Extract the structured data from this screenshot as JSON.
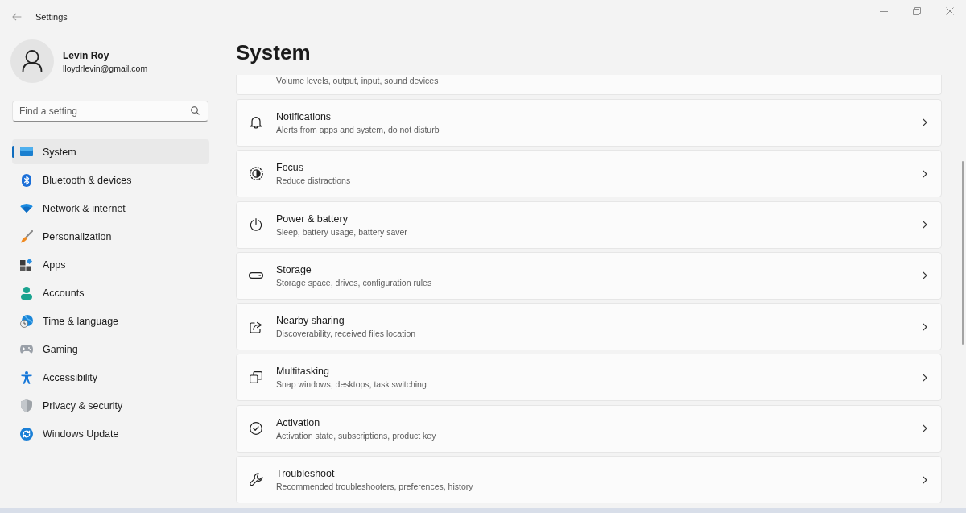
{
  "window": {
    "title": "Settings"
  },
  "profile": {
    "name": "Levin Roy",
    "email": "lloydrlevin@gmail.com"
  },
  "search": {
    "placeholder": "Find a setting"
  },
  "sidebar": {
    "items": [
      {
        "label": "System",
        "selected": true
      },
      {
        "label": "Bluetooth & devices",
        "selected": false
      },
      {
        "label": "Network & internet",
        "selected": false
      },
      {
        "label": "Personalization",
        "selected": false
      },
      {
        "label": "Apps",
        "selected": false
      },
      {
        "label": "Accounts",
        "selected": false
      },
      {
        "label": "Time & language",
        "selected": false
      },
      {
        "label": "Gaming",
        "selected": false
      },
      {
        "label": "Accessibility",
        "selected": false
      },
      {
        "label": "Privacy & security",
        "selected": false
      },
      {
        "label": "Windows Update",
        "selected": false
      }
    ]
  },
  "page": {
    "title": "System",
    "cards": [
      {
        "subtitle": "Volume levels, output, input, sound devices"
      },
      {
        "title": "Notifications",
        "subtitle": "Alerts from apps and system, do not disturb"
      },
      {
        "title": "Focus",
        "subtitle": "Reduce distractions"
      },
      {
        "title": "Power & battery",
        "subtitle": "Sleep, battery usage, battery saver"
      },
      {
        "title": "Storage",
        "subtitle": "Storage space, drives, configuration rules"
      },
      {
        "title": "Nearby sharing",
        "subtitle": "Discoverability, received files location"
      },
      {
        "title": "Multitasking",
        "subtitle": "Snap windows, desktops, task switching"
      },
      {
        "title": "Activation",
        "subtitle": "Activation state, subscriptions, product key"
      },
      {
        "title": "Troubleshoot",
        "subtitle": "Recommended troubleshooters, preferences, history"
      }
    ]
  }
}
